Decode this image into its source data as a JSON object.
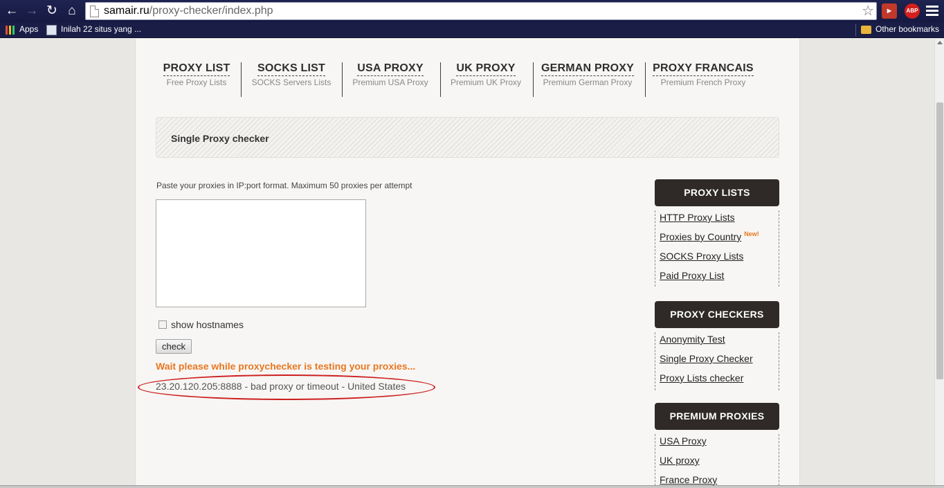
{
  "browser": {
    "url_host": "samair.ru",
    "url_path": "/proxy-checker/index.php",
    "extensions": [
      "youtube-extension",
      "ABP"
    ],
    "bookmarks": {
      "apps": "Apps",
      "item1": "Inilah 22 situs yang ...",
      "other": "Other bookmarks"
    }
  },
  "topnav": [
    {
      "title": "PROXY LIST",
      "sub": "Free Proxy Lists"
    },
    {
      "title": "SOCKS LIST",
      "sub": "SOCKS Servers Lists"
    },
    {
      "title": "USA PROXY",
      "sub": "Premium USA Proxy"
    },
    {
      "title": "UK PROXY",
      "sub": "Premium UK Proxy"
    },
    {
      "title": "GERMAN PROXY",
      "sub": "Premium German Proxy"
    },
    {
      "title": "PROXY FRANCAIS",
      "sub": "Premium French Proxy"
    }
  ],
  "main": {
    "heading": "Single Proxy checker",
    "instructions": "Paste your proxies in IP:port format. Maximum 50 proxies per attempt",
    "textarea_value": "",
    "show_hostnames_label": "show hostnames",
    "show_hostnames_checked": false,
    "check_button": "check",
    "wait_message": "Wait please while proxychecker is testing your proxies...",
    "result": "23.20.120.205:8888 - bad proxy or timeout - United States"
  },
  "sidebar": {
    "proxy_lists": {
      "heading": "PROXY LISTS",
      "links": [
        "HTTP Proxy Lists",
        "Proxies by Country",
        "SOCKS Proxy Lists",
        "Paid Proxy List"
      ],
      "new_badge": "New!"
    },
    "proxy_checkers": {
      "heading": "PROXY CHECKERS",
      "links": [
        "Anonymity Test",
        "Single Proxy Checker",
        "Proxy Lists checker"
      ]
    },
    "premium_proxies": {
      "heading": "PREMIUM PROXIES",
      "links": [
        "USA Proxy",
        "UK proxy",
        "France Proxy"
      ]
    }
  },
  "colors": {
    "accent_orange": "#e87722",
    "sidebar_header": "#2f2a27",
    "highlight_ellipse": "#cc1f1f",
    "browser_frame": "#1e2350"
  }
}
